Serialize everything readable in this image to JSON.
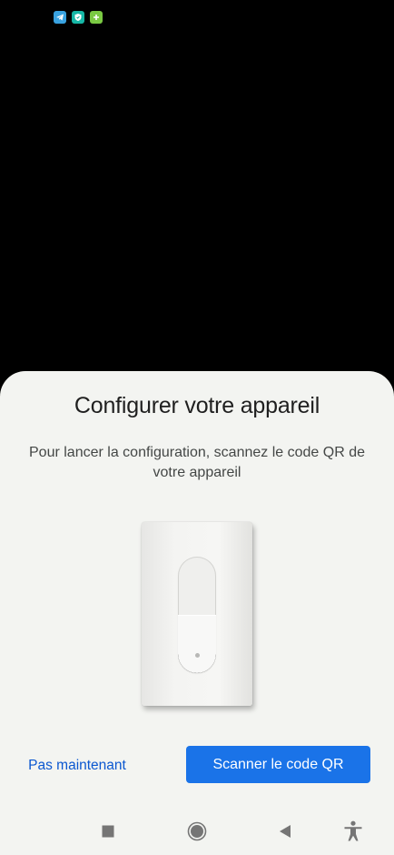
{
  "status_bar": {
    "icons": [
      "telegram-icon",
      "shield-icon",
      "plus-icon"
    ],
    "colors": {
      "telegram": "#39a2e0",
      "shield": "#16b7a6",
      "plus": "#7ac943"
    }
  },
  "sheet": {
    "title": "Configurer votre appareil",
    "description": "Pour lancer la configuration, scannez le code QR de votre appareil",
    "illustration": "light-switch-device",
    "actions": {
      "secondary_label": "Pas maintenant",
      "primary_label": "Scanner le code QR"
    },
    "colors": {
      "background": "#f3f4f1",
      "primary": "#1a73e8",
      "link": "#0b57d0"
    }
  },
  "nav_bar": {
    "icons": [
      "recents-icon",
      "home-icon",
      "back-icon",
      "accessibility-icon"
    ]
  }
}
